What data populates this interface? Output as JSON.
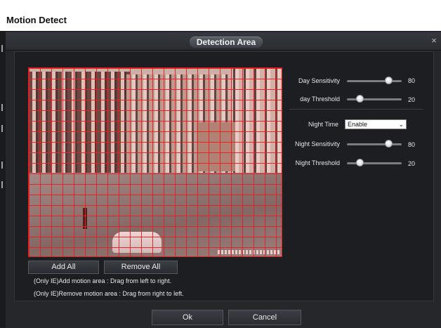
{
  "window": {
    "title": "Motion Detect"
  },
  "dialog": {
    "title": "Detection Area",
    "close_glyph": "×"
  },
  "area_buttons": {
    "add_all": "Add All",
    "remove_all": "Remove All"
  },
  "hints": [
    "(Only IE)Add motion area : Drag from left to right.",
    "(Only IE)Remove motion area : Drag from right to left."
  ],
  "settings": {
    "day_sensitivity": {
      "label": "Day Sensitivity",
      "value": "80",
      "level": 80
    },
    "day_threshold": {
      "label": "day Threshold",
      "value": "20",
      "level": 20
    },
    "night_time": {
      "label": "Night Time",
      "selected": "Enable",
      "chevron": "⌄"
    },
    "night_sensitivity": {
      "label": "Night Sensitivity",
      "value": "80",
      "level": 80
    },
    "night_threshold": {
      "label": "Night Threshold",
      "value": "20",
      "level": 20
    }
  },
  "footer": {
    "ok": "Ok",
    "cancel": "Cancel"
  },
  "colors": {
    "grid": "#e01e1e",
    "background": "#1f2126",
    "panel": "#1c1e22"
  }
}
